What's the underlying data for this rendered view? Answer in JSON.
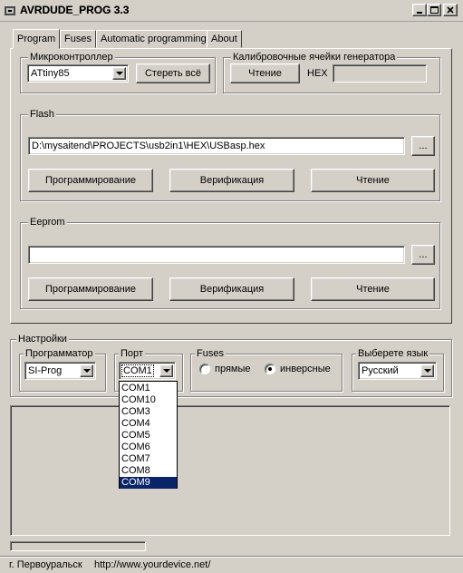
{
  "window": {
    "title": "AVRDUDE_PROG 3.3"
  },
  "tabs": [
    "Program",
    "Fuses",
    "Automatic programming",
    "About"
  ],
  "micro": {
    "legend": "Микроконтроллер",
    "selected": "ATtiny85",
    "erase_label": "Стереть всё"
  },
  "calib": {
    "legend": "Калибровочные ячейки генератора",
    "read_label": "Чтение",
    "hex_label": "HEX",
    "hex_value": ""
  },
  "flash": {
    "legend": "Flash",
    "path": "D:\\mysaitend\\PROJECTS\\usb2in1\\HEX\\USBasp.hex",
    "browse_label": "...",
    "program_label": "Программирование",
    "verify_label": "Верификация",
    "read_label": "Чтение"
  },
  "eeprom": {
    "legend": "Eeprom",
    "path": "",
    "browse_label": "...",
    "program_label": "Программирование",
    "verify_label": "Верификация",
    "read_label": "Чтение"
  },
  "settings": {
    "legend": "Настройки",
    "programmer_legend": "Программатор",
    "programmer_value": "SI-Prog",
    "port_legend": "Порт",
    "port_value": "COM1",
    "port_options": [
      "COM1",
      "COM10",
      "COM3",
      "COM4",
      "COM5",
      "COM6",
      "COM7",
      "COM8",
      "COM9"
    ],
    "port_highlighted": "COM9",
    "fuses_legend": "Fuses",
    "fuses_direct": "прямые",
    "fuses_inverse": "инверсные",
    "fuses_selected": "инверсные",
    "lang_legend": "Выберете язык",
    "lang_value": "Русский"
  },
  "status": {
    "city": "г. Первоуральск",
    "url": "http://www.yourdevice.net/"
  },
  "icons": {
    "app": "app-icon",
    "minimize": "minimize-icon",
    "maximize": "maximize-icon",
    "close": "close-icon"
  }
}
